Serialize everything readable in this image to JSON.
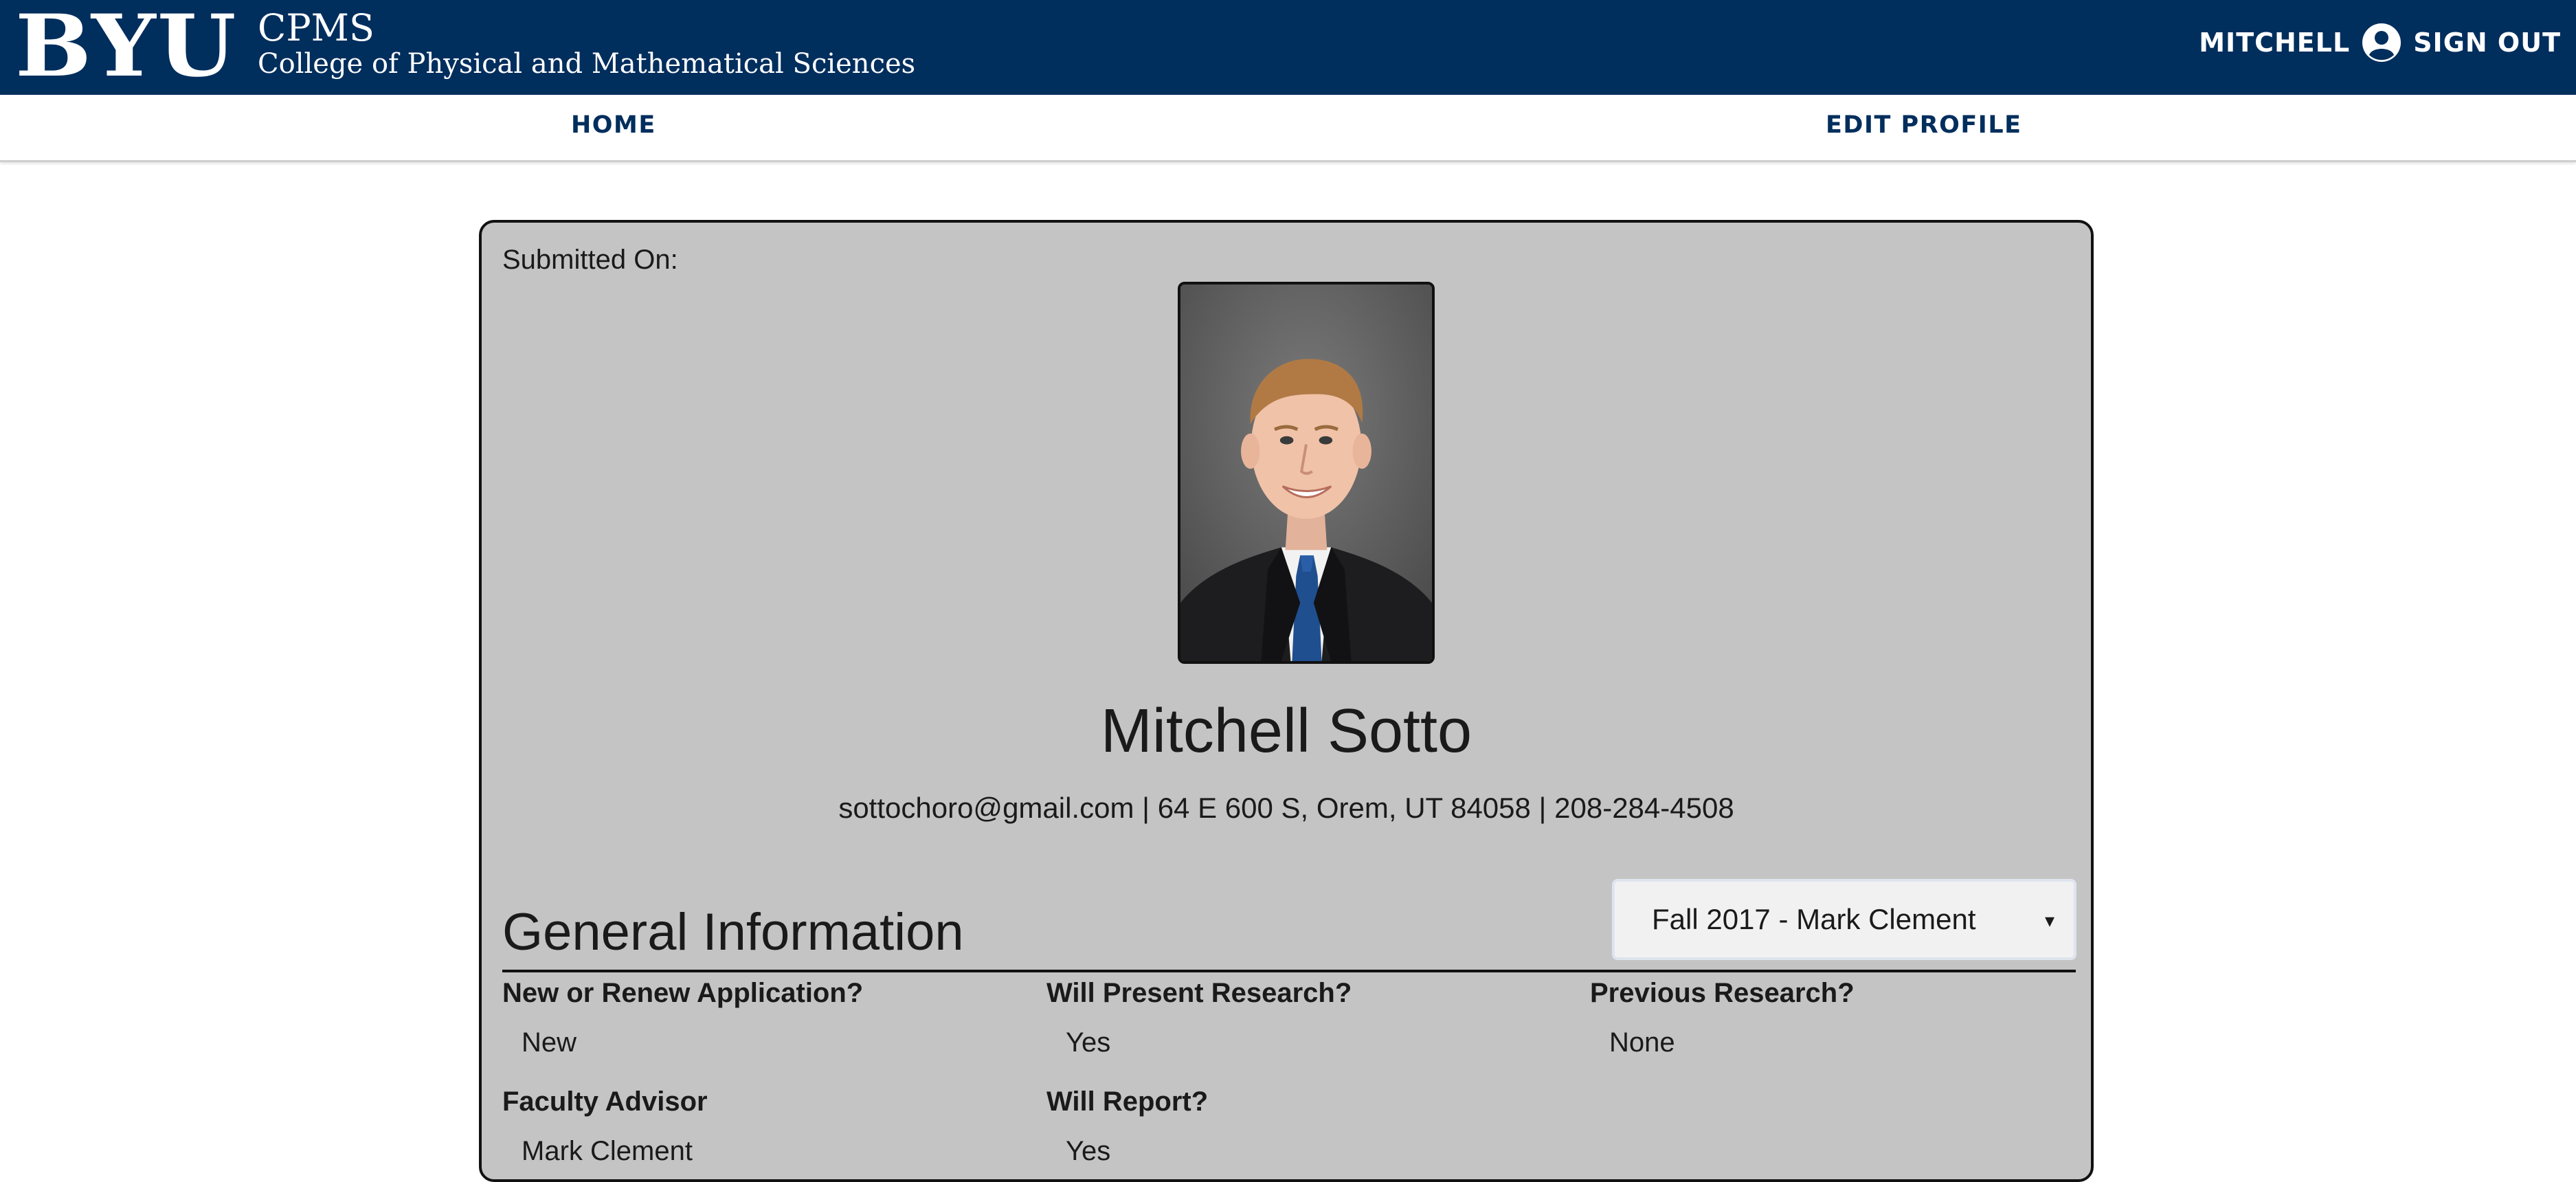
{
  "header": {
    "logo_text": "BYU",
    "app_title": "CPMS",
    "app_subtitle": "College of Physical and Mathematical Sciences",
    "user_name": "MITCHELL",
    "sign_out_label": "SIGN OUT",
    "background_color": "#002e5d"
  },
  "nav": {
    "home_label": "HOME",
    "edit_profile_label": "EDIT PROFILE"
  },
  "application": {
    "submitted_label": "Submitted On:",
    "name": "Mitchell Sotto",
    "contact": "sottochoro@gmail.com | 64 E 600 S, Orem, UT 84058 | 208-284-4508",
    "section_title": "General Information",
    "term_select": {
      "selected": "Fall 2017 - Mark Clement",
      "caret": "▾"
    },
    "fields": [
      {
        "label": "New or Renew Application?",
        "value": "New"
      },
      {
        "label": "Will Present Research?",
        "value": "Yes"
      },
      {
        "label": "Previous Research?",
        "value": "None"
      },
      {
        "label": "Faculty Advisor",
        "value": "Mark Clement"
      },
      {
        "label": "Will Report?",
        "value": "Yes"
      }
    ]
  }
}
